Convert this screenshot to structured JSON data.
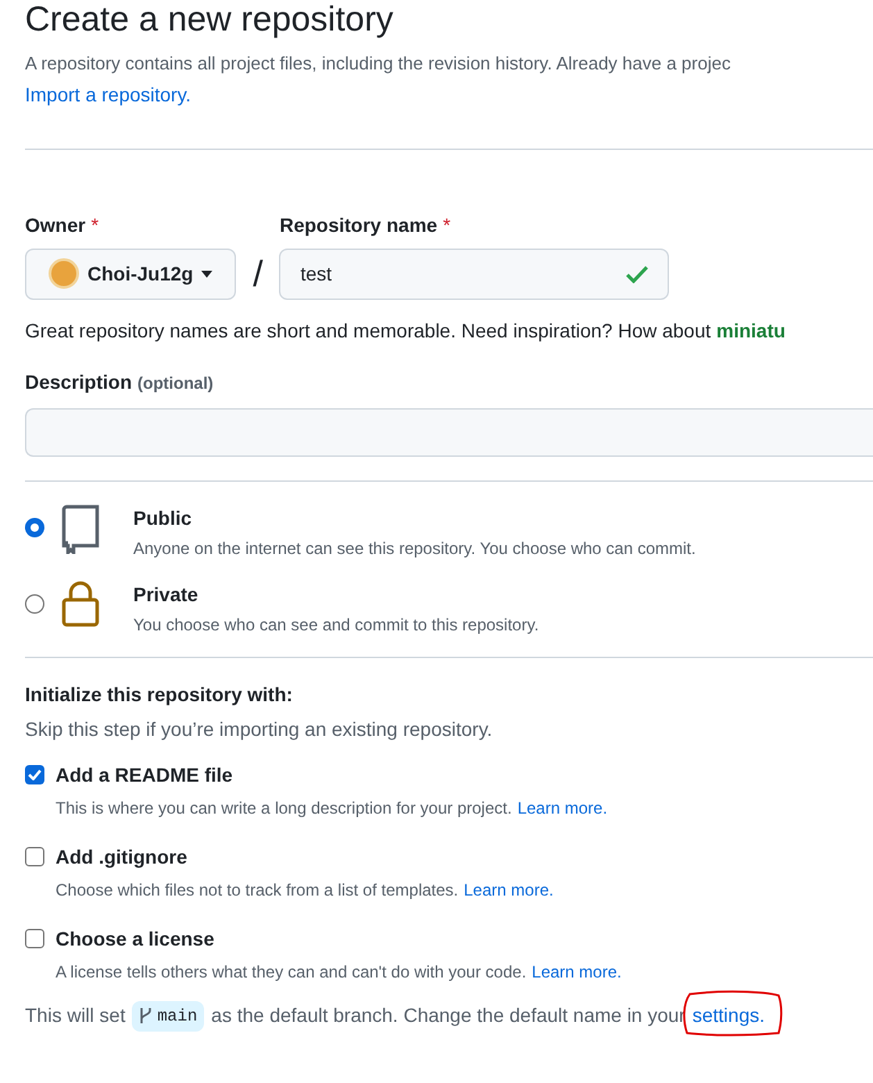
{
  "title": "Create a new repository",
  "intro": "A repository contains all project files, including the revision history. Already have a projec",
  "import_link": "Import a repository.",
  "owner": {
    "label": "Owner",
    "required_mark": "*",
    "value": "Choi-Ju12g"
  },
  "separator": "/",
  "repo_name": {
    "label": "Repository name",
    "required_mark": "*",
    "value": "test",
    "valid": true
  },
  "name_hint": {
    "text": "Great repository names are short and memorable. Need inspiration? How about",
    "suggestion": "miniatu"
  },
  "description": {
    "label": "Description",
    "optional": "(optional)"
  },
  "visibility": [
    {
      "kind": "book",
      "title": "Public",
      "text": "Anyone on the internet can see this repository. You choose who can commit.",
      "selected": true
    },
    {
      "kind": "lock",
      "title": "Private",
      "text": "You choose who can see and commit to this repository.",
      "selected": false
    }
  ],
  "initialize": {
    "heading": "Initialize this repository with:",
    "subtext": "Skip this step if you’re importing an existing repository.",
    "options": [
      {
        "label": "Add a README file",
        "text": "This is where you can write a long description for your project.",
        "link": "Learn more.",
        "checked": true
      },
      {
        "label": "Add .gitignore",
        "text": "Choose which files not to track from a list of templates.",
        "link": "Learn more.",
        "checked": false
      },
      {
        "label": "Choose a license",
        "text": "A license tells others what they can and can't do with your code.",
        "link": "Learn more.",
        "checked": false
      }
    ]
  },
  "branch_note": {
    "before": "This will set",
    "branch": "main",
    "after": "as the default branch. Change the default name in your",
    "link": "settings."
  }
}
